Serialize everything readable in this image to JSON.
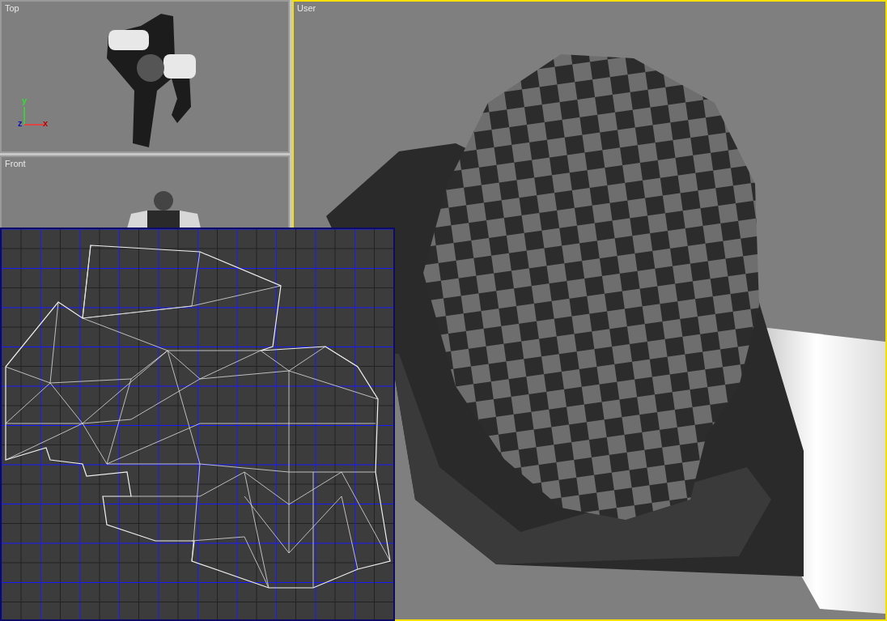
{
  "viewports": [
    {
      "label": "Top",
      "selected": false,
      "axes": [
        "y",
        "z",
        "x"
      ]
    },
    {
      "label": "Front",
      "selected": false
    },
    {
      "label": "User",
      "selected": true
    }
  ]
}
